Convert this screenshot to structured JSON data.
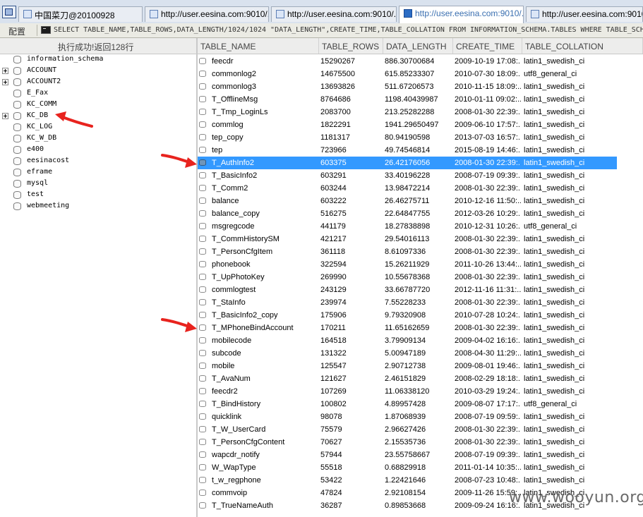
{
  "tabs": [
    {
      "label": "中国菜刀@20100928"
    },
    {
      "label": "http://user.eesina.com:9010/..."
    },
    {
      "label": "http://user.eesina.com:9010/..."
    },
    {
      "label": "http://user.eesina.com:9010/..."
    },
    {
      "label": "http://user.eesina.com:9010/..."
    }
  ],
  "toolbar": {
    "config_label": "配置",
    "sql_query": "SELECT TABLE_NAME,TABLE_ROWS,DATA_LENGTH/1024/1024 \"DATA_LENGTH\",CREATE_TIME,TABLE_COLLATION FROM INFORMATION_SCHEMA.TABLES WHERE TABLE_SCH"
  },
  "left_panel": {
    "status": "执行成功!返回128行",
    "databases": [
      {
        "name": "information_schema",
        "expandable": false
      },
      {
        "name": "ACCOUNT",
        "expandable": true
      },
      {
        "name": "ACCOUNT2",
        "expandable": true
      },
      {
        "name": "E_Fax",
        "expandable": false
      },
      {
        "name": "KC_COMM",
        "expandable": false
      },
      {
        "name": "KC_DB",
        "expandable": true
      },
      {
        "name": "KC_LOG",
        "expandable": false
      },
      {
        "name": "KC_W_DB",
        "expandable": false
      },
      {
        "name": "e400",
        "expandable": false
      },
      {
        "name": "eesinacost",
        "expandable": false
      },
      {
        "name": "eframe",
        "expandable": false
      },
      {
        "name": "mysql",
        "expandable": false
      },
      {
        "name": "test",
        "expandable": false
      },
      {
        "name": "webmeeting",
        "expandable": false
      }
    ]
  },
  "grid": {
    "columns": [
      "TABLE_NAME",
      "TABLE_ROWS",
      "DATA_LENGTH",
      "CREATE_TIME",
      "TABLE_COLLATION"
    ],
    "selected_index": 8,
    "rows": [
      [
        "feecdr",
        "15290267",
        "886.30700684",
        "2009-10-19 17:08:...",
        "latin1_swedish_ci"
      ],
      [
        "commonlog2",
        "14675500",
        "615.85233307",
        "2010-07-30 18:09:...",
        "utf8_general_ci"
      ],
      [
        "commonlog3",
        "13693826",
        "511.67206573",
        "2010-11-15 18:09:...",
        "latin1_swedish_ci"
      ],
      [
        "T_OfflineMsg",
        "8764686",
        "1198.40439987",
        "2010-01-11 09:02:...",
        "latin1_swedish_ci"
      ],
      [
        "T_Tmp_LoginLs",
        "2083700",
        "213.25282288",
        "2008-01-30 22:39:...",
        "latin1_swedish_ci"
      ],
      [
        "commlog",
        "1822291",
        "1941.29650497",
        "2009-06-10 17:57:...",
        "latin1_swedish_ci"
      ],
      [
        "tep_copy",
        "1181317",
        "80.94190598",
        "2013-07-03 16:57:...",
        "latin1_swedish_ci"
      ],
      [
        "tep",
        "723966",
        "49.74546814",
        "2015-08-19 14:46:...",
        "latin1_swedish_ci"
      ],
      [
        "T_AuthInfo2",
        "603375",
        "26.42176056",
        "2008-01-30 22:39:...",
        "latin1_swedish_ci"
      ],
      [
        "T_BasicInfo2",
        "603291",
        "33.40196228",
        "2008-07-19 09:39:...",
        "latin1_swedish_ci"
      ],
      [
        "T_Comm2",
        "603244",
        "13.98472214",
        "2008-01-30 22:39:...",
        "latin1_swedish_ci"
      ],
      [
        "balance",
        "603222",
        "26.46275711",
        "2010-12-16 11:50:...",
        "latin1_swedish_ci"
      ],
      [
        "balance_copy",
        "516275",
        "22.64847755",
        "2012-03-26 10:29:...",
        "latin1_swedish_ci"
      ],
      [
        "msgregcode",
        "441179",
        "18.27838898",
        "2010-12-31 10:26:...",
        "utf8_general_ci"
      ],
      [
        "T_CommHistorySM",
        "421217",
        "29.54016113",
        "2008-01-30 22:39:...",
        "latin1_swedish_ci"
      ],
      [
        "T_PersonCfgItem",
        "361118",
        "8.61097336",
        "2008-01-30 22:39:...",
        "latin1_swedish_ci"
      ],
      [
        "phonebook",
        "322594",
        "15.26211929",
        "2011-10-26 13:44:...",
        "latin1_swedish_ci"
      ],
      [
        "T_UpPhotoKey",
        "269990",
        "10.55678368",
        "2008-01-30 22:39:...",
        "latin1_swedish_ci"
      ],
      [
        "commlogtest",
        "243129",
        "33.66787720",
        "2012-11-16 11:31:...",
        "latin1_swedish_ci"
      ],
      [
        "T_StaInfo",
        "239974",
        "7.55228233",
        "2008-01-30 22:39:...",
        "latin1_swedish_ci"
      ],
      [
        "T_BasicInfo2_copy",
        "175906",
        "9.79320908",
        "2010-07-28 10:24:...",
        "latin1_swedish_ci"
      ],
      [
        "T_MPhoneBindAccount",
        "170211",
        "11.65162659",
        "2008-01-30 22:39:...",
        "latin1_swedish_ci"
      ],
      [
        "mobilecode",
        "164518",
        "3.79909134",
        "2009-04-02 16:16:...",
        "latin1_swedish_ci"
      ],
      [
        "subcode",
        "131322",
        "5.00947189",
        "2008-04-30 11:29:...",
        "latin1_swedish_ci"
      ],
      [
        "mobile",
        "125547",
        "2.90712738",
        "2009-08-01 19:46:...",
        "latin1_swedish_ci"
      ],
      [
        "T_AvaNum",
        "121627",
        "2.46151829",
        "2008-02-29 18:18:...",
        "latin1_swedish_ci"
      ],
      [
        "feecdr2",
        "107269",
        "11.06338120",
        "2010-03-29 19:24:...",
        "latin1_swedish_ci"
      ],
      [
        "T_BindHistory",
        "100802",
        "4.89957428",
        "2009-08-07 17:17:...",
        "utf8_general_ci"
      ],
      [
        "quicklink",
        "98078",
        "1.87068939",
        "2008-07-19 09:59:...",
        "latin1_swedish_ci"
      ],
      [
        "T_W_UserCard",
        "75579",
        "2.96627426",
        "2008-01-30 22:39:...",
        "latin1_swedish_ci"
      ],
      [
        "T_PersonCfgContent",
        "70627",
        "2.15535736",
        "2008-01-30 22:39:...",
        "latin1_swedish_ci"
      ],
      [
        "wapcdr_notify",
        "57944",
        "23.55758667",
        "2008-07-19 09:39:...",
        "latin1_swedish_ci"
      ],
      [
        "W_WapType",
        "55518",
        "0.68829918",
        "2011-01-14 10:35:...",
        "latin1_swedish_ci"
      ],
      [
        "t_w_regphone",
        "53422",
        "1.22421646",
        "2008-07-23 10:48:...",
        "latin1_swedish_ci"
      ],
      [
        "commvoip",
        "47824",
        "2.92108154",
        "2009-11-26 15:59:...",
        "latin1_swedish_ci"
      ],
      [
        "T_TrueNameAuth",
        "36287",
        "0.89853668",
        "2009-09-24 16:16:...",
        "latin1_swedish_ci"
      ]
    ]
  },
  "annotation_color": "#e8231e",
  "selection_color": "#3399ff",
  "watermark": "www.wooyun.org"
}
